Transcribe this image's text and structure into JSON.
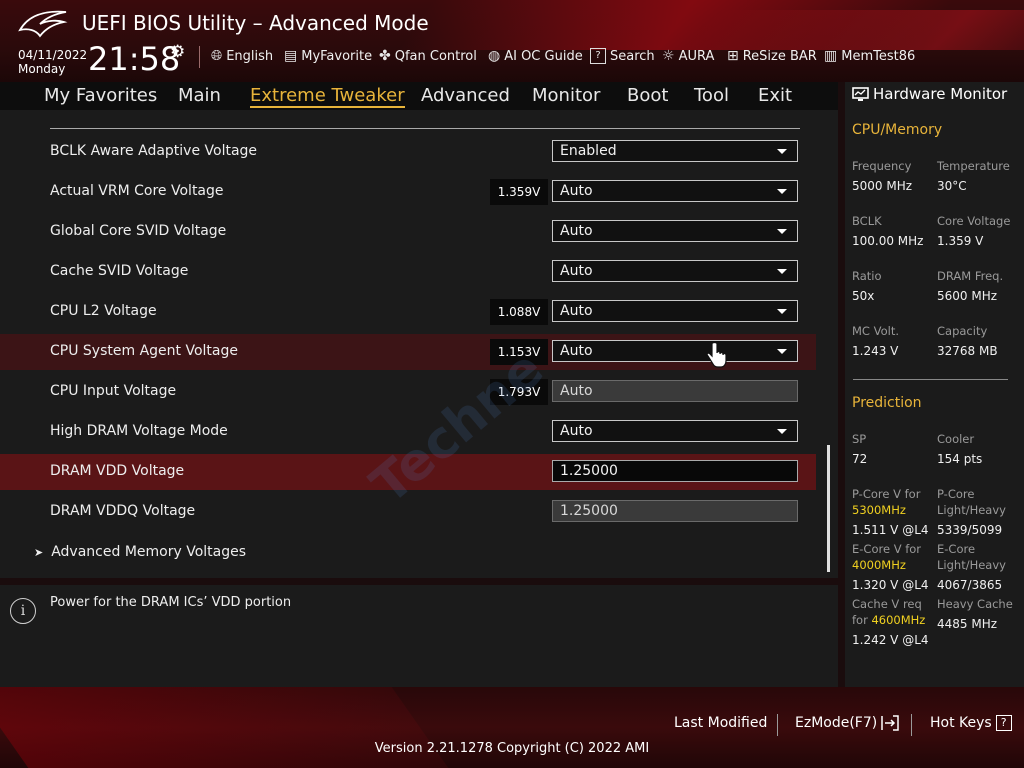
{
  "header": {
    "title": "UEFI BIOS Utility – Advanced Mode",
    "date": "04/11/2022",
    "day": "Monday",
    "time": "21:58",
    "tools": [
      {
        "label": "English",
        "icon": "globe-icon"
      },
      {
        "label": "MyFavorite",
        "icon": "favorite-list-icon"
      },
      {
        "label": "Qfan Control",
        "icon": "fan-icon"
      },
      {
        "label": "AI OC Guide",
        "icon": "ai-icon"
      },
      {
        "label": "Search",
        "icon": "help-search-icon"
      },
      {
        "label": "AURA",
        "icon": "aura-light-icon"
      },
      {
        "label": "ReSize BAR",
        "icon": "resize-bar-icon"
      },
      {
        "label": "MemTest86",
        "icon": "memory-icon"
      }
    ]
  },
  "nav": {
    "tabs": [
      "My Favorites",
      "Main",
      "Extreme Tweaker",
      "Advanced",
      "Monitor",
      "Boot",
      "Tool",
      "Exit"
    ],
    "active": "Extreme Tweaker"
  },
  "settings": {
    "rows": [
      {
        "label": "BCLK Aware Adaptive Voltage",
        "volt": "",
        "value": "Enabled"
      },
      {
        "label": "Actual VRM Core Voltage",
        "volt": "1.359V",
        "value": "Auto"
      },
      {
        "label": "Global Core SVID Voltage",
        "volt": "",
        "value": "Auto"
      },
      {
        "label": "Cache SVID Voltage",
        "volt": "",
        "value": "Auto"
      },
      {
        "label": "CPU L2 Voltage",
        "volt": "1.088V",
        "value": "Auto"
      },
      {
        "label": "CPU System Agent Voltage",
        "volt": "1.153V",
        "value": "Auto"
      },
      {
        "label": "CPU Input Voltage",
        "volt": "1.793V",
        "value": "Auto"
      },
      {
        "label": "High DRAM Voltage Mode",
        "volt": "",
        "value": "Auto"
      },
      {
        "label": "DRAM VDD Voltage",
        "volt": "",
        "value": "1.25000"
      },
      {
        "label": "DRAM VDDQ Voltage",
        "volt": "",
        "value": "1.25000"
      }
    ],
    "submenu": "Advanced Memory Voltages"
  },
  "help": {
    "text": "Power for the DRAM ICs’ VDD portion"
  },
  "hardware_monitor": {
    "title": "Hardware Monitor",
    "cpu_memory": {
      "heading": "CPU/Memory",
      "frequency_label": "Frequency",
      "frequency": "5000 MHz",
      "temperature_label": "Temperature",
      "temperature": "30°C",
      "bclk_label": "BCLK",
      "bclk": "100.00 MHz",
      "core_voltage_label": "Core Voltage",
      "core_voltage": "1.359 V",
      "ratio_label": "Ratio",
      "ratio": "50x",
      "dram_freq_label": "DRAM Freq.",
      "dram_freq": "5600 MHz",
      "mc_volt_label": "MC Volt.",
      "mc_volt": "1.243 V",
      "capacity_label": "Capacity",
      "capacity": "32768 MB"
    },
    "prediction": {
      "heading": "Prediction",
      "sp_label": "SP",
      "sp": "72",
      "cooler_label": "Cooler",
      "cooler": "154 pts",
      "pcore_v_label": "P-Core V for",
      "pcore_v_freq": "5300MHz",
      "pcore_v": "1.511 V @L4",
      "pcore_lh_label1": "P-Core",
      "pcore_lh_label2": "Light/Heavy",
      "pcore_lh": "5339/5099",
      "ecore_v_label": "E-Core V for",
      "ecore_v_freq": "4000MHz",
      "ecore_v": "1.320 V @L4",
      "ecore_lh_label1": "E-Core",
      "ecore_lh_label2": "Light/Heavy",
      "ecore_lh": "4067/3865",
      "cache_v_label1": "Cache V req",
      "cache_v_label2": "for",
      "cache_v_freq": "4600MHz",
      "cache_v": "1.242 V @L4",
      "heavy_cache_label": "Heavy Cache",
      "heavy_cache": "4485 MHz"
    }
  },
  "footer": {
    "last_modified": "Last Modified",
    "ezmode": "EzMode(F7)",
    "hotkeys": "Hot Keys",
    "hotkeys_icon_text": "?",
    "version": "Version 2.21.1278 Copyright (C) 2022 AMI"
  },
  "watermark": "Techne",
  "colors": {
    "accent": "#e8b43a",
    "highlight_row": "#3c1416",
    "selected_row": "#5a1416",
    "prediction_freq": "#f0d020"
  }
}
